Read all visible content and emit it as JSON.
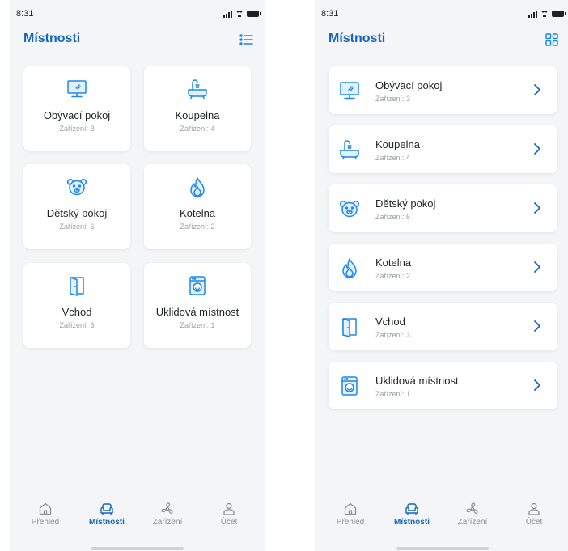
{
  "status": {
    "time": "8:31"
  },
  "title": "Místnosti",
  "rooms": [
    {
      "name": "Obývací pokoj",
      "devices": "Zařízení: 3",
      "icon": "tv-icon"
    },
    {
      "name": "Koupelna",
      "devices": "Zařízení: 4",
      "icon": "bathtub-icon"
    },
    {
      "name": "Dětský pokoj",
      "devices": "Zařízení: 6",
      "icon": "teddy-bear-icon"
    },
    {
      "name": "Kotelna",
      "devices": "Zařízení: 2",
      "icon": "flame-icon"
    },
    {
      "name": "Vchod",
      "devices": "Zařízení: 3",
      "icon": "door-icon"
    },
    {
      "name": "Uklidová místnost",
      "devices": "Zařízení: 1",
      "icon": "washing-machine-icon"
    }
  ],
  "tabs": [
    {
      "label": "Přehled",
      "icon": "home-icon"
    },
    {
      "label": "Místnosti",
      "icon": "sofa-icon"
    },
    {
      "label": "Zařízení",
      "icon": "fan-icon"
    },
    {
      "label": "Účet",
      "icon": "user-icon"
    }
  ],
  "views": {
    "left": {
      "mode": "grid",
      "toggle_icon": "list-view-icon",
      "active_tab": "Místnosti"
    },
    "right": {
      "mode": "list",
      "toggle_icon": "grid-view-icon",
      "active_tab": "Místnosti"
    }
  },
  "colors": {
    "accent": "#1565c0",
    "icon": "#1e88e5",
    "background": "#f4f5f7",
    "muted": "#9aa0a6"
  }
}
